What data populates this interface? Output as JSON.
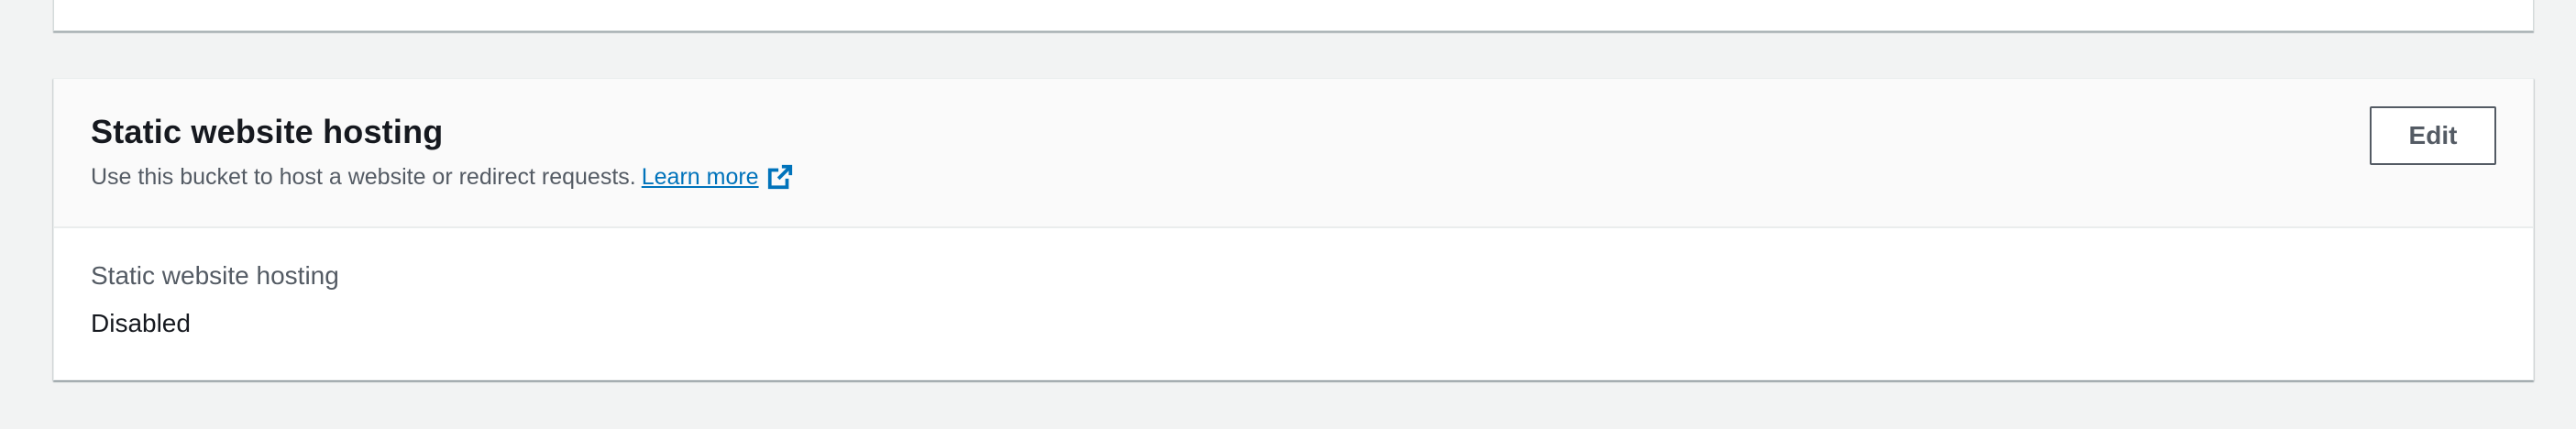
{
  "section": {
    "title": "Static website hosting",
    "description": "Use this bucket to host a website or redirect requests.",
    "learn_more_label": "Learn more",
    "learn_more_icon": "external-link-icon",
    "edit_label": "Edit"
  },
  "field": {
    "label": "Static website hosting",
    "value": "Disabled"
  },
  "colors": {
    "page_background": "#f2f3f3",
    "link": "#0073bb",
    "text": "#16191f",
    "secondary_text": "#545b64"
  }
}
